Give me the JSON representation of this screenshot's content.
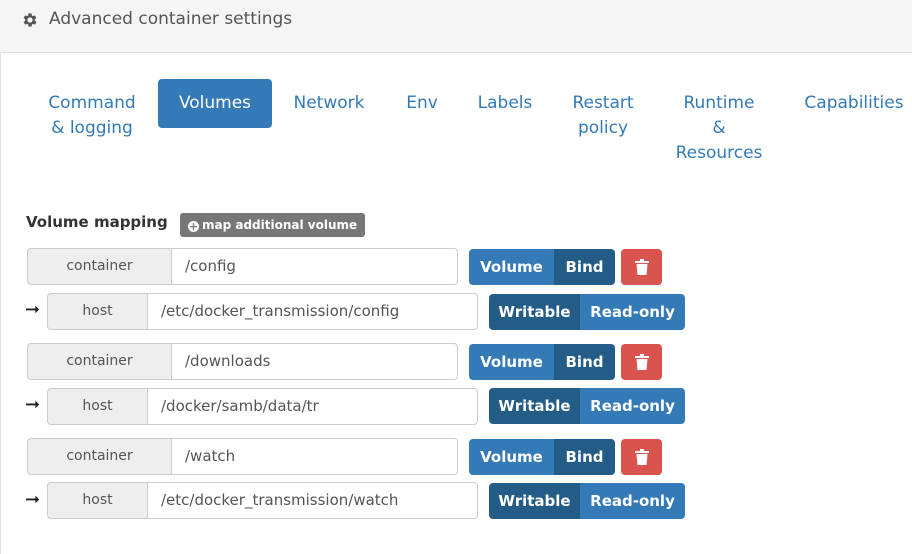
{
  "panel": {
    "title": "Advanced container settings",
    "icon": "gear-icon"
  },
  "tabs": [
    {
      "label_lines": [
        "Command",
        "& logging"
      ],
      "active": false
    },
    {
      "label_lines": [
        "Volumes"
      ],
      "active": true
    },
    {
      "label_lines": [
        "Network"
      ],
      "active": false
    },
    {
      "label_lines": [
        "Env"
      ],
      "active": false
    },
    {
      "label_lines": [
        "Labels"
      ],
      "active": false
    },
    {
      "label_lines": [
        "Restart",
        "policy"
      ],
      "active": false
    },
    {
      "label_lines": [
        "Runtime",
        "&",
        "Resources"
      ],
      "active": false
    },
    {
      "label_lines": [
        "Capabilities"
      ],
      "active": false
    }
  ],
  "volumes": {
    "label": "Volume mapping",
    "add_button": "map additional volume",
    "mappings": [
      {
        "container_label": "container",
        "container_path": "/config",
        "type_options": [
          "Volume",
          "Bind"
        ],
        "type_selected": "Bind",
        "host_label": "host",
        "host_path": "/etc/docker_transmission/config",
        "mode_options": [
          "Writable",
          "Read-only"
        ],
        "mode_selected": "Writable"
      },
      {
        "container_label": "container",
        "container_path": "/downloads",
        "type_options": [
          "Volume",
          "Bind"
        ],
        "type_selected": "Bind",
        "host_label": "host",
        "host_path": "/docker/samb/data/tr",
        "mode_options": [
          "Writable",
          "Read-only"
        ],
        "mode_selected": "Writable"
      },
      {
        "container_label": "container",
        "container_path": "/watch",
        "type_options": [
          "Volume",
          "Bind"
        ],
        "type_selected": "Bind",
        "host_label": "host",
        "host_path": "/etc/docker_transmission/watch",
        "mode_options": [
          "Writable",
          "Read-only"
        ],
        "mode_selected": "Writable"
      }
    ]
  },
  "colors": {
    "primary": "#337ab7",
    "primary_active": "#245c88",
    "danger": "#d9534f",
    "default_dark": "#777777"
  }
}
